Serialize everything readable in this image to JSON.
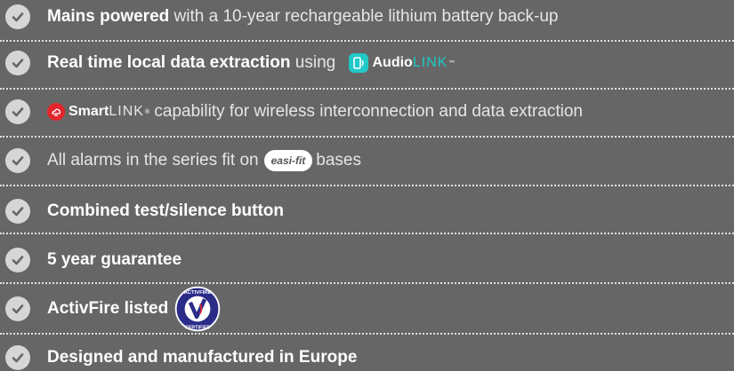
{
  "colors": {
    "background": "#666666",
    "check_circle": "#d6d6d6",
    "audiolink_accent": "#1fc7c7",
    "smartlink_red": "#e2262e",
    "activfire_blue": "#2a2c88"
  },
  "features": [
    {
      "bold": "Mains powered",
      "text": " with a 10-year rechargeable lithium battery back-up"
    },
    {
      "bold": "Real time local data extraction",
      "text": " using "
    },
    {
      "text": " capability for wireless interconnection and data extraction"
    },
    {
      "text_before": "All alarms in the series fit on",
      "text_after": "bases"
    },
    {
      "bold": "Combined test/silence button"
    },
    {
      "bold": "5 year guarantee"
    },
    {
      "bold": "ActivFire listed"
    },
    {
      "bold": "Designed and manufactured in Europe"
    }
  ],
  "logos": {
    "audiolink": {
      "part1": "Audio",
      "part2": "LINK",
      "tm": "™",
      "icon": "phone-sound-icon"
    },
    "smartlink": {
      "part1": "Smart",
      "part2": "LINK",
      "tm": "®",
      "icon": "wifi-cloud-icon"
    },
    "easifit": {
      "text": "easi-fit"
    },
    "activfire": {
      "top": "ACTIVFIRE",
      "bottom": "CERTIFIED"
    }
  }
}
